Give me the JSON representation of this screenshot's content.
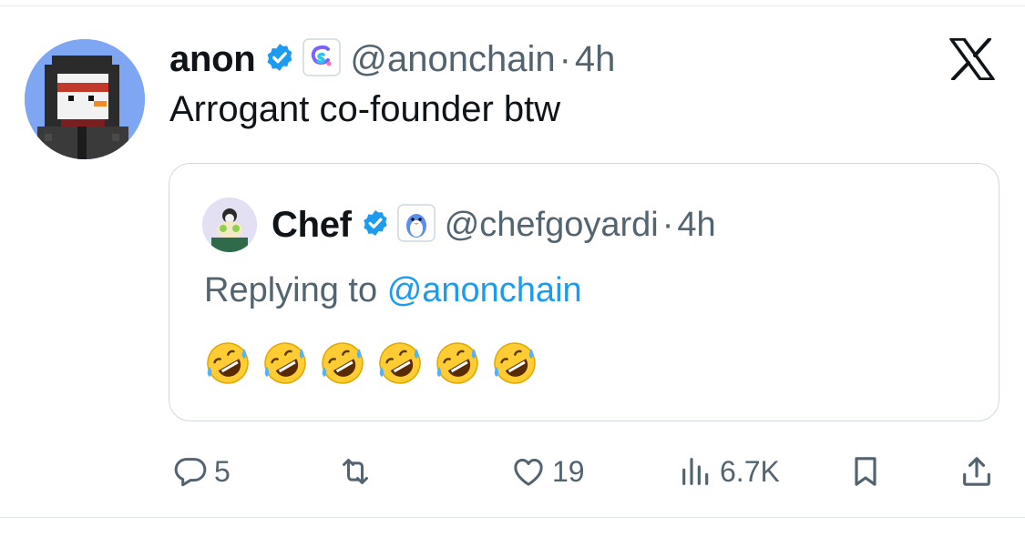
{
  "tweet": {
    "author_name": "anon",
    "author_handle": "@anonchain",
    "separator": "·",
    "time": "4h",
    "text": "Arrogant co-founder btw"
  },
  "quote": {
    "author_name": "Chef",
    "author_handle": "@chefgoyardi",
    "separator": "·",
    "time": "4h",
    "replying_prefix": "Replying to",
    "replying_mention": "@anonchain",
    "emojis": [
      "🤣",
      "🤣",
      "🤣",
      "🤣",
      "🤣",
      "🤣"
    ]
  },
  "actions": {
    "replies": "5",
    "retweets": "",
    "likes": "19",
    "views": "6.7K"
  },
  "colors": {
    "accent": "#1d9bf0",
    "verified": "#1d9bf0",
    "text_primary": "#0f1419",
    "text_secondary": "#536471",
    "border": "#cfd9de"
  },
  "icons": {
    "verified": "verified-badge-icon",
    "affiliation_anon": "colorful-cs-logo-icon",
    "affiliation_chef": "penguin-icon",
    "brand": "x-logo-icon",
    "reply": "comment-icon",
    "retweet": "retweet-icon",
    "like": "heart-icon",
    "views": "views-bar-icon",
    "bookmark": "bookmark-icon",
    "share": "share-icon"
  }
}
